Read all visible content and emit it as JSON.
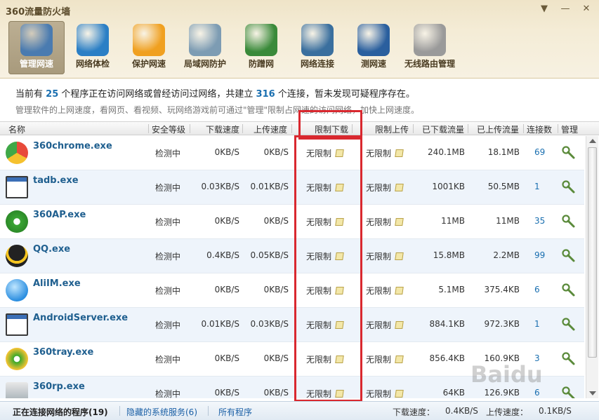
{
  "window": {
    "title": "360流量防火墙",
    "btn_menu": "▼",
    "btn_min": "—",
    "btn_close": "✕"
  },
  "toolbar": [
    {
      "label": "管理网速",
      "icon": "monitor-chart-icon",
      "color": "#4a7bb0"
    },
    {
      "label": "网络体检",
      "icon": "heartbeat-globe-icon",
      "color": "#2b7fc5"
    },
    {
      "label": "保护网速",
      "icon": "lightning-shield-icon",
      "color": "#f0a020"
    },
    {
      "label": "局域网防护",
      "icon": "firewall-wall-icon",
      "color": "#7d9cb3"
    },
    {
      "label": "防蹭网",
      "icon": "globe-shield-icon",
      "color": "#3a8a3a"
    },
    {
      "label": "网络连接",
      "icon": "connection-monitor-icon",
      "color": "#3a6f9e"
    },
    {
      "label": "测网速",
      "icon": "speedometer-icon",
      "color": "#2a5f9e"
    },
    {
      "label": "无线路由管理",
      "icon": "wifi-router-icon",
      "color": "#9a9a9a"
    }
  ],
  "info": {
    "line1_a": "当前有",
    "program_count": "25",
    "line1_b": "个程序正在访问网络或曾经访问过网络，共建立",
    "connection_count": "316",
    "line1_c": "个连接，暂未发现可疑程序存在。",
    "line2": "管理软件的上网速度，看网页、看视频、玩网络游戏前可通过\"管理\"限制占网速的访问网络，加快上网速度。"
  },
  "columns": [
    "名称",
    "安全等级",
    "下载速度",
    "上传速度",
    "限制下载",
    "限制上传",
    "已下载流量",
    "已上传流量",
    "连接数",
    "管理"
  ],
  "rows": [
    {
      "name": "360chrome.exe",
      "icon": "chrome-360-icon",
      "security": "检测中",
      "down": "0KB/S",
      "up": "0KB/S",
      "limit_down": "无限制",
      "limit_up": "无限制",
      "downloaded": "240.1MB",
      "uploaded": "18.1MB",
      "conns": "69"
    },
    {
      "name": "tadb.exe",
      "icon": "window-app-icon",
      "security": "检测中",
      "down": "0.03KB/S",
      "up": "0.01KB/S",
      "limit_down": "无限制",
      "limit_up": "无限制",
      "downloaded": "1001KB",
      "uploaded": "50.5MB",
      "conns": "1"
    },
    {
      "name": "360AP.exe",
      "icon": "wifi-green-icon",
      "security": "检测中",
      "down": "0KB/S",
      "up": "0KB/S",
      "limit_down": "无限制",
      "limit_up": "无限制",
      "downloaded": "11MB",
      "uploaded": "11MB",
      "conns": "35"
    },
    {
      "name": "QQ.exe",
      "icon": "qq-penguin-icon",
      "security": "检测中",
      "down": "0.4KB/S",
      "up": "0.05KB/S",
      "limit_down": "无限制",
      "limit_up": "无限制",
      "downloaded": "15.8MB",
      "uploaded": "2.2MB",
      "conns": "99"
    },
    {
      "name": "AliIM.exe",
      "icon": "aliim-drop-icon",
      "security": "检测中",
      "down": "0KB/S",
      "up": "0KB/S",
      "limit_down": "无限制",
      "limit_up": "无限制",
      "downloaded": "5.1MB",
      "uploaded": "375.4KB",
      "conns": "6"
    },
    {
      "name": "AndroidServer.exe",
      "icon": "window-app-icon",
      "security": "检测中",
      "down": "0.01KB/S",
      "up": "0.03KB/S",
      "limit_down": "无限制",
      "limit_up": "无限制",
      "downloaded": "884.1KB",
      "uploaded": "972.3KB",
      "conns": "1"
    },
    {
      "name": "360tray.exe",
      "icon": "plus-green-icon",
      "security": "检测中",
      "down": "0KB/S",
      "up": "0KB/S",
      "limit_down": "无限制",
      "limit_up": "无限制",
      "downloaded": "856.4KB",
      "uploaded": "160.9KB",
      "conns": "3"
    },
    {
      "name": "360rp.exe",
      "icon": "shield-app-icon",
      "security": "检测中",
      "down": "0KB/S",
      "up": "0KB/S",
      "limit_down": "无限制",
      "limit_up": "无限制",
      "downloaded": "64KB",
      "uploaded": "126.9KB",
      "conns": "6"
    }
  ],
  "status": {
    "active_tab": "正在连接网络的程序(19)",
    "hidden_tab": "隐藏的系统服务(6)",
    "all_tab": "所有程序",
    "down_label": "下载速度：",
    "down_value": "0.4KB/S",
    "up_label": "上传速度：",
    "up_value": "0.1KB/S"
  },
  "watermark": "Baidu"
}
